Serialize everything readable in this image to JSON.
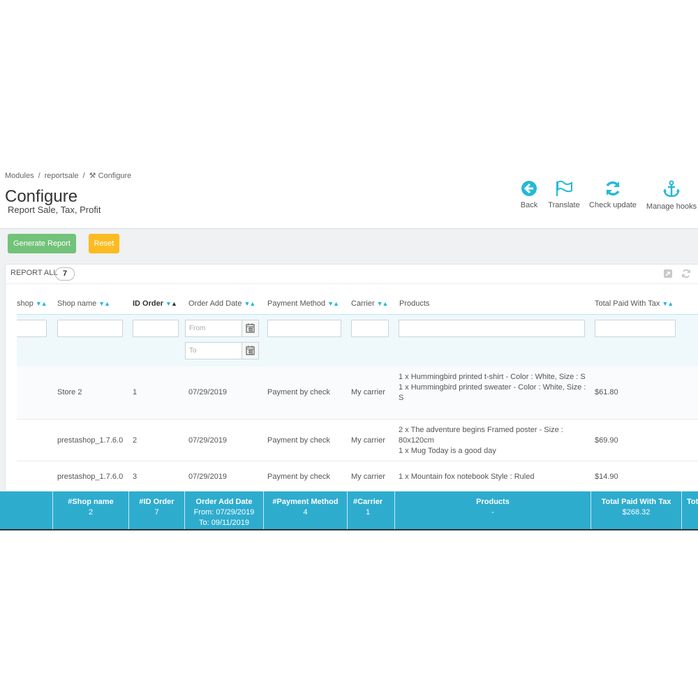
{
  "breadcrumb": {
    "items": [
      "Modules",
      "reportsale"
    ],
    "current": "Configure"
  },
  "page": {
    "title": "Configure",
    "subtitle": "Report Sale, Tax, Profit"
  },
  "toolbar": {
    "back": "Back",
    "translate": "Translate",
    "check_update": "Check update",
    "manage_hooks": "Manage hooks"
  },
  "actions": {
    "generate": "Generate Report",
    "reset": "Reset"
  },
  "panel": {
    "title": "REPORT ALL",
    "count": "7"
  },
  "columns": {
    "shop": "shop",
    "shop_name": "Shop name",
    "id_order": "ID Order",
    "order_date": "Order Add Date",
    "payment": "Payment Method",
    "carrier": "Carrier",
    "products": "Products",
    "total": "Total Paid With Tax"
  },
  "filters": {
    "from_placeholder": "From",
    "to_placeholder": "To"
  },
  "rows": [
    {
      "shop_name": "Store 2",
      "id": "1",
      "date": "07/29/2019",
      "payment": "Payment by check",
      "carrier": "My carrier",
      "products": [
        "1 x Hummingbird printed t-shirt - Color : White, Size : S",
        "1 x Hummingbird printed sweater - Color : White, Size : S"
      ],
      "total": "$61.80"
    },
    {
      "shop_name": "prestashop_1.7.6.0",
      "id": "2",
      "date": "07/29/2019",
      "payment": "Payment by check",
      "carrier": "My carrier",
      "products": [
        "2 x The adventure begins Framed poster - Size : 80x120cm",
        "1 x Mug Today is a good day"
      ],
      "total": "$69.90"
    },
    {
      "shop_name": "prestashop_1.7.6.0",
      "id": "3",
      "date": "07/29/2019",
      "payment": "Payment by check",
      "carrier": "My carrier",
      "products": [
        "1 x Mountain fox notebook Style : Ruled"
      ],
      "total": "$14.90"
    }
  ],
  "summary": {
    "shop_name": {
      "label": "#Shop name",
      "value": "2"
    },
    "id_order": {
      "label": "#ID Order",
      "value": "7"
    },
    "order_date": {
      "label": "Order Add Date",
      "from": "From: 07/29/2019",
      "to": "To: 09/11/2019"
    },
    "payment": {
      "label": "#Payment Method",
      "value": "4"
    },
    "carrier": {
      "label": "#Carrier",
      "value": "1"
    },
    "products": {
      "label": "Products",
      "value": "-"
    },
    "total": {
      "label": "Total Paid With Tax",
      "value": "$268.32"
    },
    "next": {
      "label": "Tot"
    }
  },
  "colors": {
    "accent": "#25b9d7",
    "success": "#72c279",
    "warning": "#fbbb22",
    "summary": "#2eacce"
  }
}
